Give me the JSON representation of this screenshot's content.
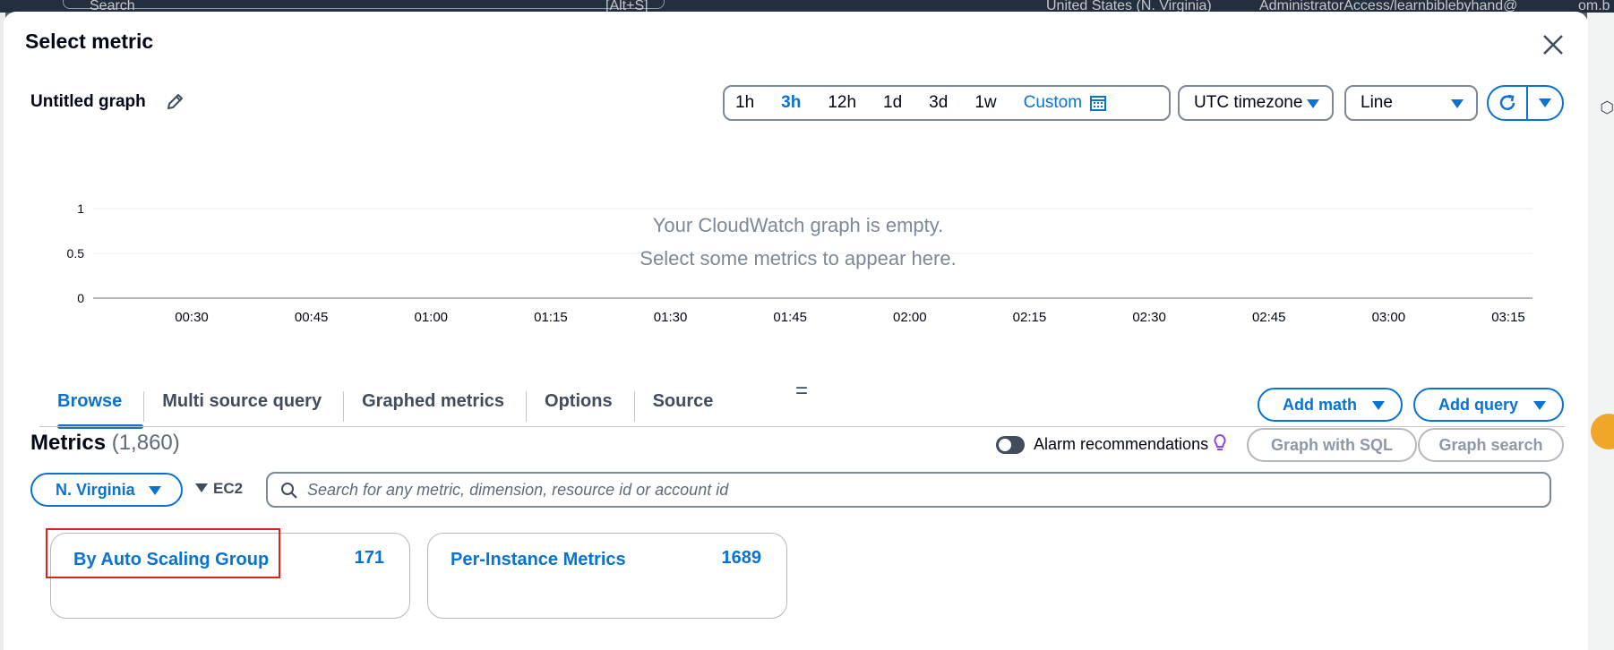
{
  "background": {
    "topbar_fragments": [
      "Search",
      "[Alt+S]",
      "United States (N. Virginia)",
      "AdministratorAccess/learnbiblebyhand@",
      "om.b"
    ]
  },
  "modal": {
    "title": "Select metric",
    "close_icon": "close-icon"
  },
  "graph": {
    "title": "Untitled graph",
    "edit_icon": "pencil-icon",
    "time_ranges": [
      "1h",
      "3h",
      "12h",
      "1d",
      "3d",
      "1w"
    ],
    "active_range": "3h",
    "custom_label": "Custom",
    "timezone": "UTC timezone",
    "chart_style": "Line",
    "empty_line1": "Your CloudWatch graph is empty.",
    "empty_line2": "Select some metrics to appear here."
  },
  "chart_data": {
    "type": "line",
    "title": "",
    "xlabel": "",
    "ylabel": "",
    "x_ticks": [
      "00:30",
      "00:45",
      "01:00",
      "01:15",
      "01:30",
      "01:45",
      "02:00",
      "02:15",
      "02:30",
      "02:45",
      "03:00",
      "03:15"
    ],
    "y_ticks": [
      "1",
      "0.5",
      "0"
    ],
    "ylim": [
      0,
      1
    ],
    "series": [],
    "grid": true
  },
  "tabs": {
    "items": [
      "Browse",
      "Multi source query",
      "Graphed metrics",
      "Options",
      "Source"
    ],
    "active": "Browse",
    "drag_handle": "="
  },
  "actions": {
    "add_math": "Add math",
    "add_query": "Add query"
  },
  "metrics": {
    "title": "Metrics",
    "count": "(1,860)",
    "alarm_recommendations": "Alarm recommendations",
    "graph_with_sql": "Graph with SQL",
    "graph_search": "Graph search",
    "region": "N. Virginia",
    "namespace": "EC2",
    "search_placeholder": "Search for any metric, dimension, resource id or account id",
    "cards": [
      {
        "label": "By Auto Scaling Group",
        "count": "171"
      },
      {
        "label": "Per-Instance Metrics",
        "count": "1689"
      }
    ]
  },
  "colors": {
    "accent": "#0972d3",
    "highlight": "#e0201b",
    "text": "#000716"
  }
}
